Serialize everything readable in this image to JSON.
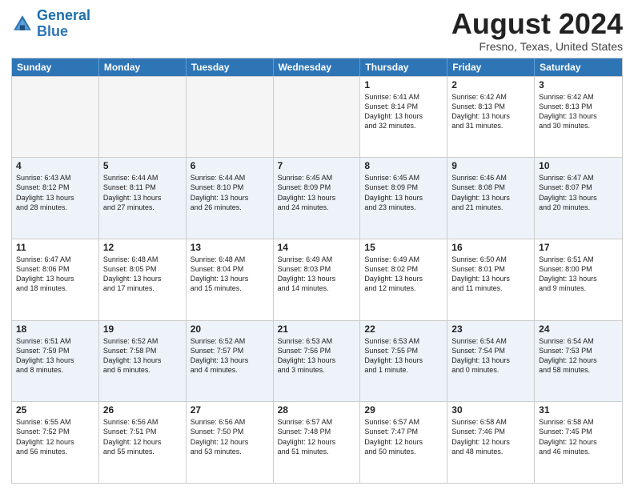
{
  "header": {
    "logo_general": "General",
    "logo_blue": "Blue",
    "month_title": "August 2024",
    "location": "Fresno, Texas, United States"
  },
  "days_of_week": [
    "Sunday",
    "Monday",
    "Tuesday",
    "Wednesday",
    "Thursday",
    "Friday",
    "Saturday"
  ],
  "rows": [
    {
      "alt": false,
      "cells": [
        {
          "day": "",
          "content": ""
        },
        {
          "day": "",
          "content": ""
        },
        {
          "day": "",
          "content": ""
        },
        {
          "day": "",
          "content": ""
        },
        {
          "day": "1",
          "content": "Sunrise: 6:41 AM\nSunset: 8:14 PM\nDaylight: 13 hours\nand 32 minutes."
        },
        {
          "day": "2",
          "content": "Sunrise: 6:42 AM\nSunset: 8:13 PM\nDaylight: 13 hours\nand 31 minutes."
        },
        {
          "day": "3",
          "content": "Sunrise: 6:42 AM\nSunset: 8:13 PM\nDaylight: 13 hours\nand 30 minutes."
        }
      ]
    },
    {
      "alt": true,
      "cells": [
        {
          "day": "4",
          "content": "Sunrise: 6:43 AM\nSunset: 8:12 PM\nDaylight: 13 hours\nand 28 minutes."
        },
        {
          "day": "5",
          "content": "Sunrise: 6:44 AM\nSunset: 8:11 PM\nDaylight: 13 hours\nand 27 minutes."
        },
        {
          "day": "6",
          "content": "Sunrise: 6:44 AM\nSunset: 8:10 PM\nDaylight: 13 hours\nand 26 minutes."
        },
        {
          "day": "7",
          "content": "Sunrise: 6:45 AM\nSunset: 8:09 PM\nDaylight: 13 hours\nand 24 minutes."
        },
        {
          "day": "8",
          "content": "Sunrise: 6:45 AM\nSunset: 8:09 PM\nDaylight: 13 hours\nand 23 minutes."
        },
        {
          "day": "9",
          "content": "Sunrise: 6:46 AM\nSunset: 8:08 PM\nDaylight: 13 hours\nand 21 minutes."
        },
        {
          "day": "10",
          "content": "Sunrise: 6:47 AM\nSunset: 8:07 PM\nDaylight: 13 hours\nand 20 minutes."
        }
      ]
    },
    {
      "alt": false,
      "cells": [
        {
          "day": "11",
          "content": "Sunrise: 6:47 AM\nSunset: 8:06 PM\nDaylight: 13 hours\nand 18 minutes."
        },
        {
          "day": "12",
          "content": "Sunrise: 6:48 AM\nSunset: 8:05 PM\nDaylight: 13 hours\nand 17 minutes."
        },
        {
          "day": "13",
          "content": "Sunrise: 6:48 AM\nSunset: 8:04 PM\nDaylight: 13 hours\nand 15 minutes."
        },
        {
          "day": "14",
          "content": "Sunrise: 6:49 AM\nSunset: 8:03 PM\nDaylight: 13 hours\nand 14 minutes."
        },
        {
          "day": "15",
          "content": "Sunrise: 6:49 AM\nSunset: 8:02 PM\nDaylight: 13 hours\nand 12 minutes."
        },
        {
          "day": "16",
          "content": "Sunrise: 6:50 AM\nSunset: 8:01 PM\nDaylight: 13 hours\nand 11 minutes."
        },
        {
          "day": "17",
          "content": "Sunrise: 6:51 AM\nSunset: 8:00 PM\nDaylight: 13 hours\nand 9 minutes."
        }
      ]
    },
    {
      "alt": true,
      "cells": [
        {
          "day": "18",
          "content": "Sunrise: 6:51 AM\nSunset: 7:59 PM\nDaylight: 13 hours\nand 8 minutes."
        },
        {
          "day": "19",
          "content": "Sunrise: 6:52 AM\nSunset: 7:58 PM\nDaylight: 13 hours\nand 6 minutes."
        },
        {
          "day": "20",
          "content": "Sunrise: 6:52 AM\nSunset: 7:57 PM\nDaylight: 13 hours\nand 4 minutes."
        },
        {
          "day": "21",
          "content": "Sunrise: 6:53 AM\nSunset: 7:56 PM\nDaylight: 13 hours\nand 3 minutes."
        },
        {
          "day": "22",
          "content": "Sunrise: 6:53 AM\nSunset: 7:55 PM\nDaylight: 13 hours\nand 1 minute."
        },
        {
          "day": "23",
          "content": "Sunrise: 6:54 AM\nSunset: 7:54 PM\nDaylight: 13 hours\nand 0 minutes."
        },
        {
          "day": "24",
          "content": "Sunrise: 6:54 AM\nSunset: 7:53 PM\nDaylight: 12 hours\nand 58 minutes."
        }
      ]
    },
    {
      "alt": false,
      "cells": [
        {
          "day": "25",
          "content": "Sunrise: 6:55 AM\nSunset: 7:52 PM\nDaylight: 12 hours\nand 56 minutes."
        },
        {
          "day": "26",
          "content": "Sunrise: 6:56 AM\nSunset: 7:51 PM\nDaylight: 12 hours\nand 55 minutes."
        },
        {
          "day": "27",
          "content": "Sunrise: 6:56 AM\nSunset: 7:50 PM\nDaylight: 12 hours\nand 53 minutes."
        },
        {
          "day": "28",
          "content": "Sunrise: 6:57 AM\nSunset: 7:48 PM\nDaylight: 12 hours\nand 51 minutes."
        },
        {
          "day": "29",
          "content": "Sunrise: 6:57 AM\nSunset: 7:47 PM\nDaylight: 12 hours\nand 50 minutes."
        },
        {
          "day": "30",
          "content": "Sunrise: 6:58 AM\nSunset: 7:46 PM\nDaylight: 12 hours\nand 48 minutes."
        },
        {
          "day": "31",
          "content": "Sunrise: 6:58 AM\nSunset: 7:45 PM\nDaylight: 12 hours\nand 46 minutes."
        }
      ]
    }
  ]
}
